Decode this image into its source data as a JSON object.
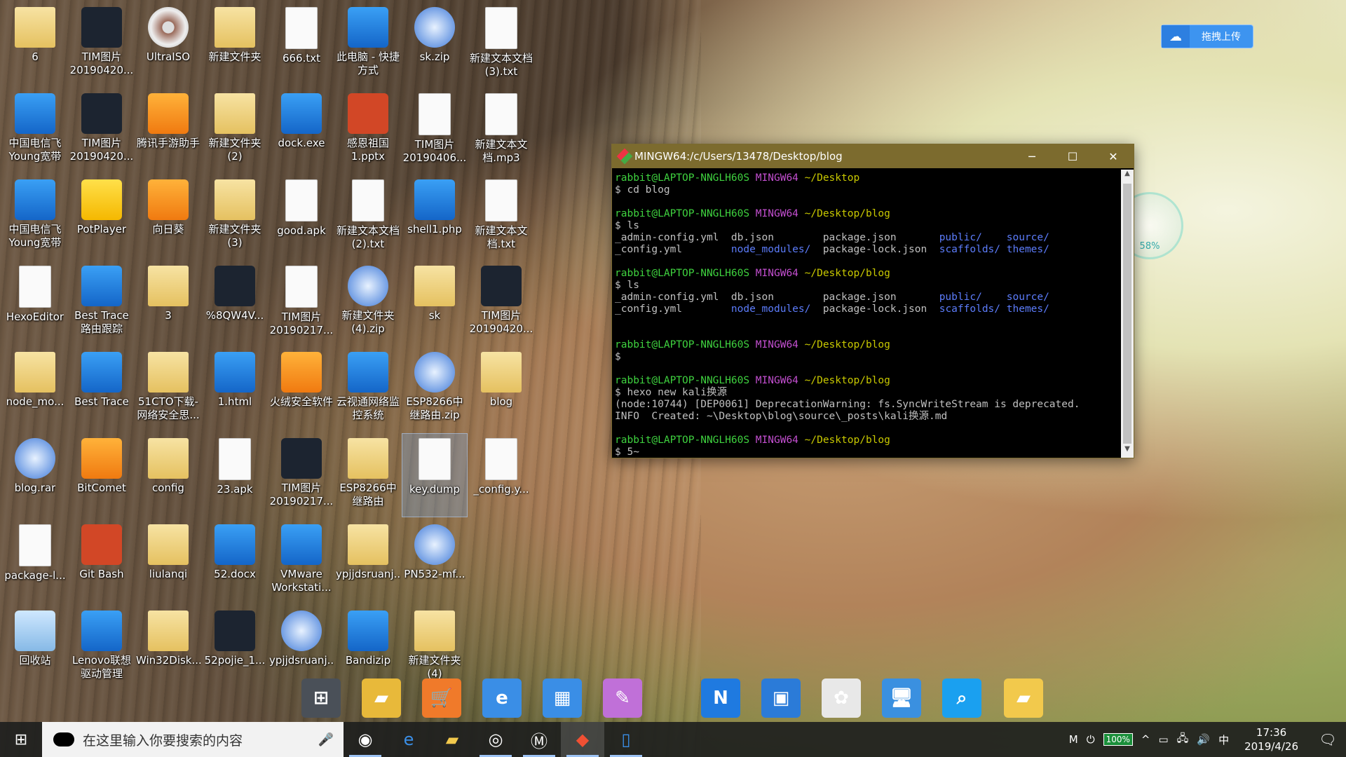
{
  "desktop": {
    "icons": [
      {
        "label": "6",
        "type": "folder"
      },
      {
        "label": "TIM图片\n20190420...",
        "type": "dark"
      },
      {
        "label": "UltraISO",
        "type": "disc"
      },
      {
        "label": "新建文件夹",
        "type": "folder"
      },
      {
        "label": "666.txt",
        "type": "file"
      },
      {
        "label": "此电脑 - 快捷\n方式",
        "type": "blue"
      },
      {
        "label": "sk.zip",
        "type": "zip"
      },
      {
        "label": "新建文本文档\n(3).txt",
        "type": "file"
      },
      {
        "label": "中国电信飞\nYoung宽带",
        "type": "blue"
      },
      {
        "label": "TIM图片\n20190420...",
        "type": "dark"
      },
      {
        "label": "腾讯手游助手",
        "type": "orange"
      },
      {
        "label": "新建文件夹\n(2)",
        "type": "folder"
      },
      {
        "label": "dock.exe",
        "type": "blue"
      },
      {
        "label": "感恩祖国\n1.pptx",
        "type": "red"
      },
      {
        "label": "TIM图片\n20190406...",
        "type": "file"
      },
      {
        "label": "新建文本文\n档.mp3",
        "type": "file"
      },
      {
        "label": "中国电信飞\nYoung宽带",
        "type": "blue"
      },
      {
        "label": "PotPlayer",
        "type": "yellow"
      },
      {
        "label": "向日葵",
        "type": "orange"
      },
      {
        "label": "新建文件夹\n(3)",
        "type": "folder"
      },
      {
        "label": "good.apk",
        "type": "file"
      },
      {
        "label": "新建文本文档\n(2).txt",
        "type": "file"
      },
      {
        "label": "shell1.php",
        "type": "blue"
      },
      {
        "label": "新建文本文\n档.txt",
        "type": "file"
      },
      {
        "label": "HexoEditor",
        "type": "file"
      },
      {
        "label": "Best Trace\n路由跟踪",
        "type": "blue"
      },
      {
        "label": "3",
        "type": "folder"
      },
      {
        "label": "%8QW4V...",
        "type": "dark"
      },
      {
        "label": "TIM图片\n20190217...",
        "type": "file"
      },
      {
        "label": "新建文件夹\n(4).zip",
        "type": "zip"
      },
      {
        "label": "sk",
        "type": "folder"
      },
      {
        "label": "TIM图片\n20190420...",
        "type": "dark"
      },
      {
        "label": "node_mo...",
        "type": "folder"
      },
      {
        "label": "Best Trace",
        "type": "blue"
      },
      {
        "label": "51CTO下载-\n网络安全思...",
        "type": "folder"
      },
      {
        "label": "1.html",
        "type": "blue"
      },
      {
        "label": "火绒安全软件",
        "type": "orange"
      },
      {
        "label": "云视通网络监\n控系统",
        "type": "blue"
      },
      {
        "label": "ESP8266中\n继路由.zip",
        "type": "zip"
      },
      {
        "label": "blog",
        "type": "folder"
      },
      {
        "label": "blog.rar",
        "type": "zip"
      },
      {
        "label": "BitComet",
        "type": "orange"
      },
      {
        "label": "config",
        "type": "folder"
      },
      {
        "label": "23.apk",
        "type": "file"
      },
      {
        "label": "TIM图片\n20190217...",
        "type": "dark"
      },
      {
        "label": "ESP8266中\n继路由",
        "type": "folder"
      },
      {
        "label": "key.dump",
        "type": "file",
        "selected": true
      },
      {
        "label": "_config.y...",
        "type": "file"
      },
      {
        "label": "package-l...",
        "type": "file"
      },
      {
        "label": "Git Bash",
        "type": "red"
      },
      {
        "label": "liulanqi",
        "type": "folder"
      },
      {
        "label": "52.docx",
        "type": "blue"
      },
      {
        "label": "VMware\nWorkstati...",
        "type": "blue"
      },
      {
        "label": "ypjjdsruanj...",
        "type": "folder"
      },
      {
        "label": "PN532-mf...",
        "type": "zip"
      },
      {
        "label": "",
        "type": "none"
      },
      {
        "label": "回收站",
        "type": "recycle"
      },
      {
        "label": "Lenovo联想\n驱动管理",
        "type": "blue"
      },
      {
        "label": "Win32Disk...",
        "type": "folder"
      },
      {
        "label": "52pojie_1...",
        "type": "dark"
      },
      {
        "label": "ypjjdsruanj...",
        "type": "zip"
      },
      {
        "label": "Bandizip",
        "type": "blue"
      },
      {
        "label": "新建文件夹\n(4)",
        "type": "folder"
      },
      {
        "label": "",
        "type": "none"
      }
    ]
  },
  "terminal": {
    "title": "MINGW64:/c/Users/13478/Desktop/blog",
    "lines": [
      {
        "user": "rabbit@LAPTOP-NNGLH60S",
        "host": "MINGW64",
        "path": "~/Desktop"
      },
      {
        "text": "$ cd blog"
      },
      {
        "text": ""
      },
      {
        "user": "rabbit@LAPTOP-NNGLH60S",
        "host": "MINGW64",
        "path": "~/Desktop/blog"
      },
      {
        "text": "$ ls"
      },
      {
        "cols": [
          "_admin-config.yml",
          "db.json",
          "package.json",
          "public/",
          "source/"
        ]
      },
      {
        "cols": [
          "_config.yml",
          "node_modules/",
          "package-lock.json",
          "scaffolds/",
          "themes/"
        ]
      },
      {
        "text": ""
      },
      {
        "user": "rabbit@LAPTOP-NNGLH60S",
        "host": "MINGW64",
        "path": "~/Desktop/blog"
      },
      {
        "text": "$ ls"
      },
      {
        "cols": [
          "_admin-config.yml",
          "db.json",
          "package.json",
          "public/",
          "source/"
        ]
      },
      {
        "cols": [
          "_config.yml",
          "node_modules/",
          "package-lock.json",
          "scaffolds/",
          "themes/"
        ]
      },
      {
        "text": ""
      },
      {
        "text": ""
      },
      {
        "user": "rabbit@LAPTOP-NNGLH60S",
        "host": "MINGW64",
        "path": "~/Desktop/blog"
      },
      {
        "text": "$"
      },
      {
        "text": ""
      },
      {
        "user": "rabbit@LAPTOP-NNGLH60S",
        "host": "MINGW64",
        "path": "~/Desktop/blog"
      },
      {
        "text": "$ hexo new kali换源"
      },
      {
        "text": "(node:10744) [DEP0061] DeprecationWarning: fs.SyncWriteStream is deprecated."
      },
      {
        "text": "INFO  Created: ~\\Desktop\\blog\\source\\_posts\\kali换源.md"
      },
      {
        "text": ""
      },
      {
        "user": "rabbit@LAPTOP-NNGLH60S",
        "host": "MINGW64",
        "path": "~/Desktop/blog"
      },
      {
        "text": "$ 5~"
      }
    ]
  },
  "upload_widget": {
    "label": "拖拽上传"
  },
  "speed_ball": {
    "percent": "58%"
  },
  "dock": [
    "start",
    "folder",
    "store",
    "ie",
    "files",
    "tools",
    "nk",
    "vm",
    "photos",
    "pc",
    "search",
    "folder2"
  ],
  "taskbar": {
    "search_placeholder": "在这里输入你要搜索的内容",
    "apps": [
      "chrome",
      "edge",
      "explorer",
      "groove",
      "hexo",
      "gitbash",
      "phone"
    ],
    "tray_ime": "M",
    "battery": "100%",
    "lang": "中",
    "time": "17:36",
    "date": "2019/4/26"
  }
}
